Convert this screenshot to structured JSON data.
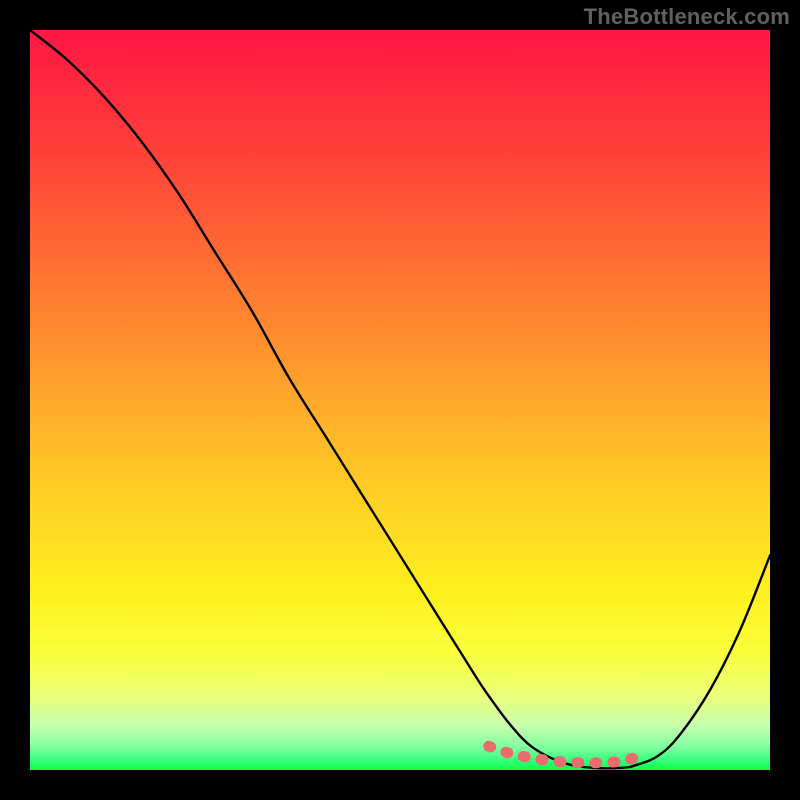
{
  "watermark": "TheBottleneck.com",
  "chart_data": {
    "type": "line",
    "title": "",
    "xlabel": "",
    "ylabel": "",
    "xlim": [
      0,
      100
    ],
    "ylim": [
      0,
      100
    ],
    "grid": false,
    "legend": false,
    "series": [
      {
        "name": "bottleneck-curve",
        "color": "#000000",
        "x": [
          0,
          5,
          10,
          15,
          20,
          25,
          30,
          35,
          40,
          45,
          50,
          55,
          60,
          62,
          65,
          68,
          72,
          76,
          80,
          82,
          85,
          88,
          92,
          96,
          100
        ],
        "y": [
          100,
          96,
          91,
          85,
          78,
          70,
          62,
          53,
          45,
          37,
          29,
          21,
          13,
          10,
          6,
          3,
          1,
          0.3,
          0.3,
          0.7,
          2,
          5,
          11,
          19,
          29
        ]
      },
      {
        "name": "optimal-zone-marker",
        "color": "#e86d6c",
        "x": [
          62,
          65,
          68,
          71,
          74,
          77,
          80,
          82,
          83
        ],
        "y": [
          3.2,
          2.2,
          1.6,
          1.2,
          1.0,
          1.0,
          1.2,
          1.8,
          2.4
        ]
      }
    ],
    "gradient_stops": [
      {
        "pos": 0,
        "color": "#ff1744"
      },
      {
        "pos": 50,
        "color": "#ffb529"
      },
      {
        "pos": 80,
        "color": "#fbff3a"
      },
      {
        "pos": 100,
        "color": "#0bff40"
      }
    ]
  }
}
